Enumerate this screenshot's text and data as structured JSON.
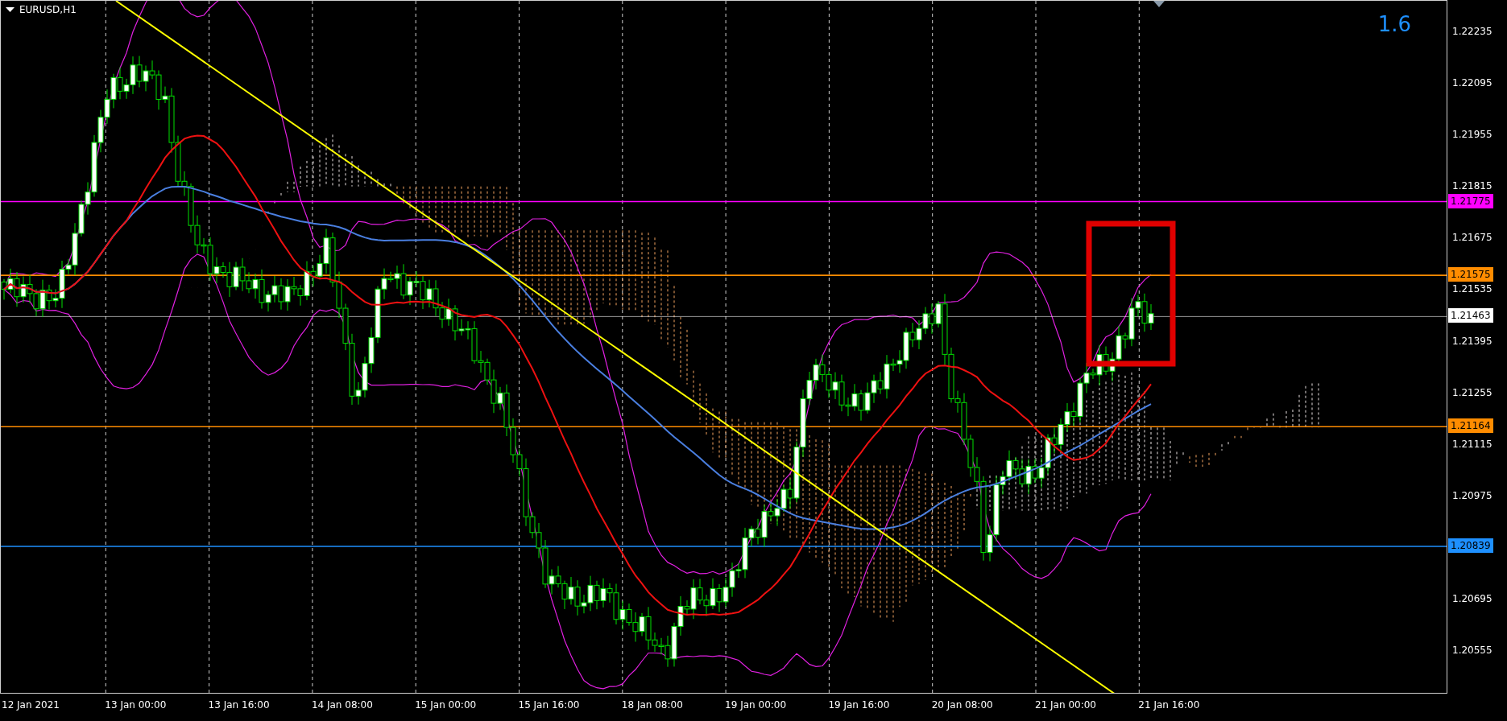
{
  "chart": {
    "symbol": "EURUSD,H1",
    "indicator_value": "1.6",
    "price_axis": [
      "1.22235",
      "1.22095",
      "1.21955",
      "1.21815",
      "1.21675",
      "1.21535",
      "1.21395",
      "1.21255",
      "1.21115",
      "1.20975",
      "1.20695",
      "1.20555"
    ],
    "levels": [
      {
        "price": "1.21775",
        "color": "#ff00ff"
      },
      {
        "price": "1.21575",
        "color": "#ff8c00"
      },
      {
        "price": "1.21463",
        "color": "#ffffff"
      },
      {
        "price": "1.21164",
        "color": "#ff8c00"
      },
      {
        "price": "1.20839",
        "color": "#1e90ff"
      }
    ],
    "time_axis": [
      "12 Jan 2021",
      "13 Jan 00:00",
      "13 Jan 16:00",
      "14 Jan 08:00",
      "15 Jan 00:00",
      "15 Jan 16:00",
      "18 Jan 08:00",
      "19 Jan 00:00",
      "19 Jan 16:00",
      "20 Jan 08:00",
      "21 Jan 00:00",
      "21 Jan 16:00"
    ]
  }
}
